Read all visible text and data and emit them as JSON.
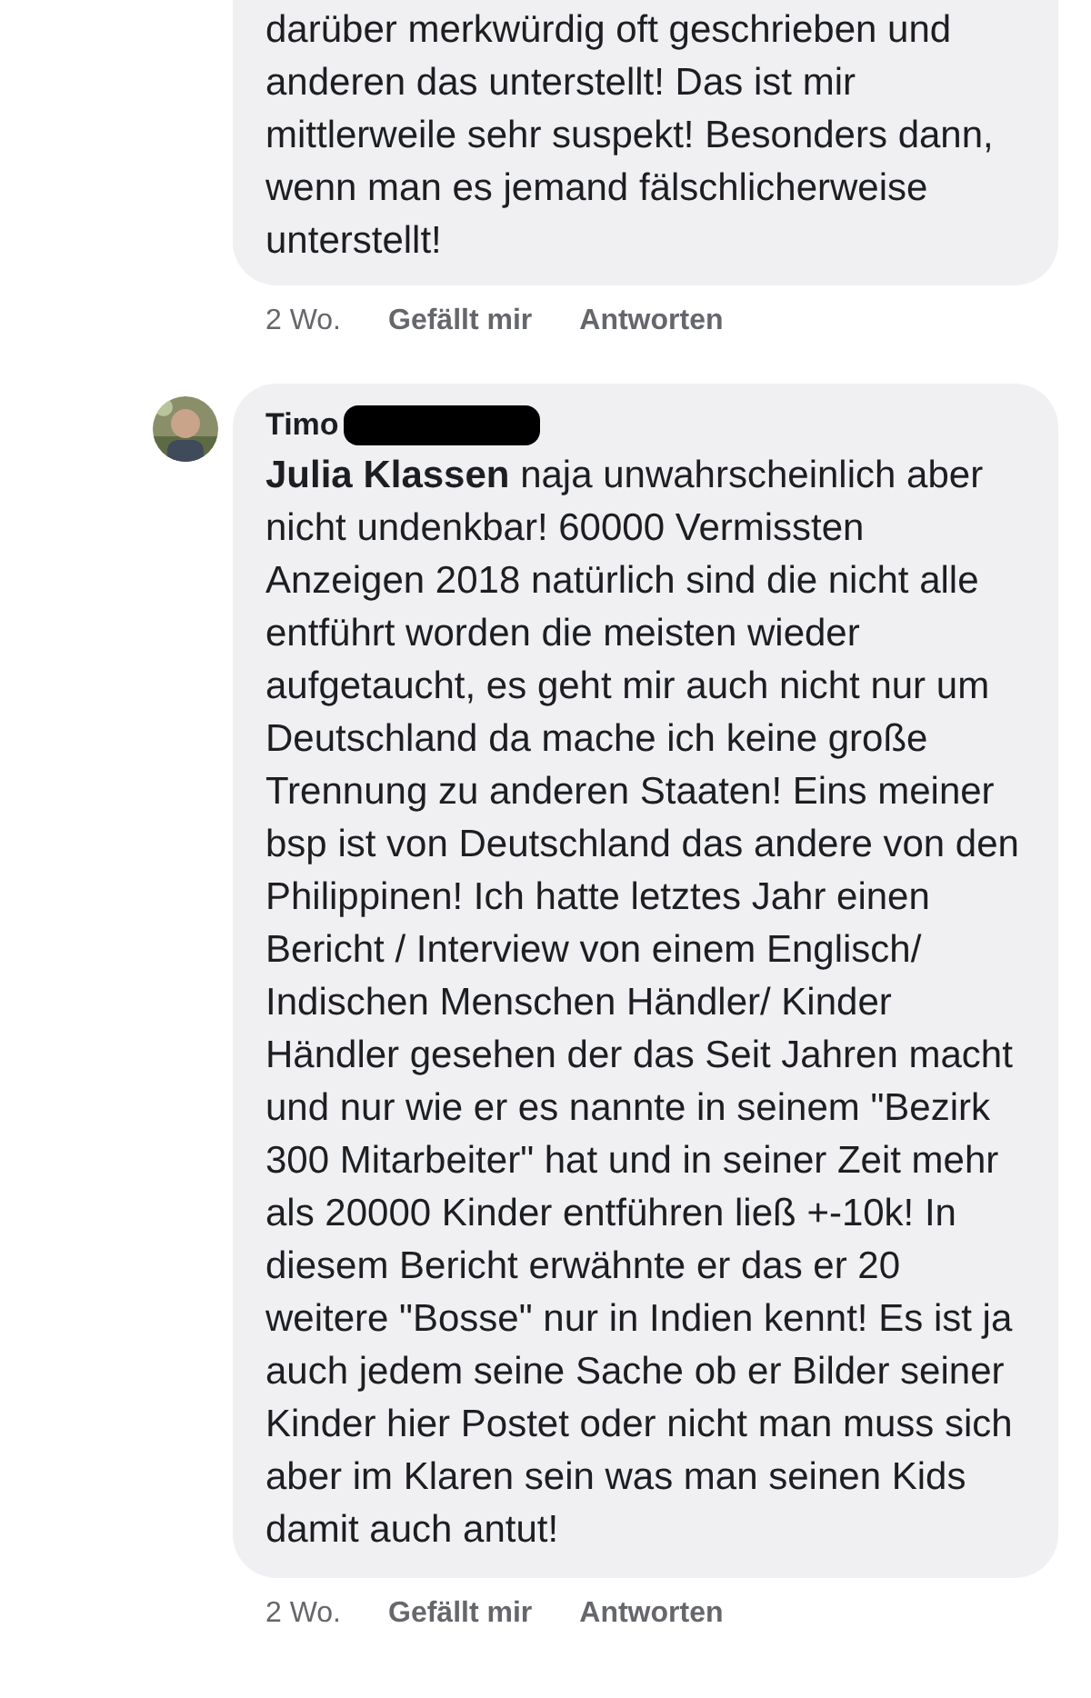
{
  "comments": [
    {
      "text": "darüber merkwürdig oft geschrieben und anderen das unterstellt! Das ist mir mittlerweile sehr suspekt! Besonders dann, wenn man es jemand fälschlicherweise unterstellt!",
      "time": "2 Wo.",
      "like": "Gefällt mir",
      "reply": "Antworten"
    },
    {
      "author": "Timo",
      "name_redacted": true,
      "text": "**Julia Klassen** naja unwahrscheinlich aber nicht undenkbar! 60000 Vermissten Anzeigen 2018 natürlich sind die nicht alle entführt worden die meisten wieder aufgetaucht, es geht mir auch nicht nur um Deutschland da mache ich keine große Trennung zu anderen Staaten! Eins meiner bsp ist von Deutschland das andere von den Philippinen! Ich hatte letztes Jahr einen Bericht / Interview von einem Englisch/ Indischen Menschen Händler/ Kinder Händler gesehen der das Seit Jahren macht und nur wie er es nannte in seinem \"Bezirk 300 Mitarbeiter\" hat und in seiner Zeit mehr als 20000 Kinder entführen ließ +-10k! In diesem Bericht erwähnte er das er 20 weitere \"Bosse\" nur in Indien kennt! Es ist ja auch jedem seine Sache ob er Bilder seiner Kinder hier Postet oder nicht man muss sich aber im Klaren sein was man seinen Kids damit auch antut!",
      "time": "2 Wo.",
      "like": "Gefällt mir",
      "reply": "Antworten"
    }
  ]
}
